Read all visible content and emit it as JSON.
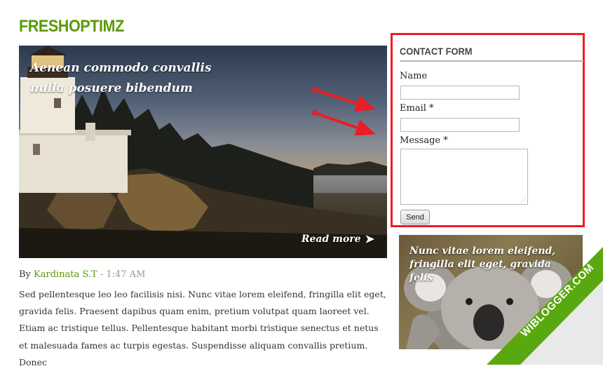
{
  "site": {
    "title": "FRESHOPTIMZ"
  },
  "featured": {
    "title": "Aenean commodo convallis nulla posuere bibendum",
    "read_more": "Read more",
    "read_more_icon": "double-arrow-icon"
  },
  "meta": {
    "by": "By",
    "author": "Kardinata S.T",
    "separator": "-",
    "time": "1:47 AM"
  },
  "excerpt": "Sed pellentesque leo leo facilisis nisi. Nunc vitae lorem eleifend, fringilla elit eget, gravida felis. Praesent dapibus quam enim, pretium volutpat quam laoreet vel. Etiam ac tristique tellus. Pellentesque habitant morbi tristique senectus et netus et malesuada fames ac turpis egestas. Suspendisse aliquam convallis pretium. Donec",
  "contact_form": {
    "title": "CONTACT FORM",
    "name_label": "Name",
    "email_label": "Email *",
    "message_label": "Message *",
    "name_value": "",
    "email_value": "",
    "message_value": "",
    "send_label": "Send"
  },
  "side_post": {
    "title": "Nunc vitae lorem eleifend, fringilla elit eget, gravida felis"
  },
  "corner_badge": {
    "text": "WIBLOGGER.COM"
  },
  "colors": {
    "brand_green": "#5a9a06",
    "highlight_red": "#ee1c24",
    "ribbon_green": "#5aa80f"
  }
}
